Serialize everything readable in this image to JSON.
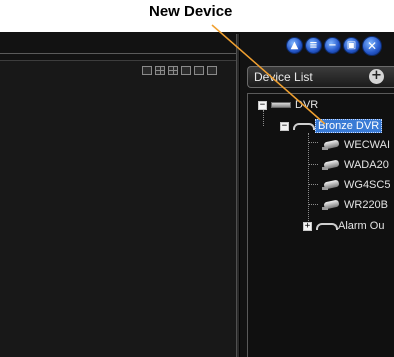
{
  "callout": {
    "text": "New Device"
  },
  "device_list": {
    "title": "Device List",
    "add_symbol": "+"
  },
  "window_buttons": [
    {
      "icon": "lock-icon",
      "symbol": "▲"
    },
    {
      "icon": "list-icon",
      "symbol": "≡"
    },
    {
      "icon": "minimize-icon",
      "symbol": "−"
    },
    {
      "icon": "restore-icon",
      "symbol": "▣"
    },
    {
      "icon": "close-icon",
      "symbol": "✕"
    }
  ],
  "tree": {
    "root": {
      "label": "DVR",
      "toggle": "−"
    },
    "bronze": {
      "label": "Bronze DVR",
      "toggle": "−"
    },
    "cameras": [
      "WECWAI",
      "WADA20",
      "WG4SC5",
      "WR220B"
    ],
    "alarm": {
      "label": "Alarm Ou",
      "toggle": "+"
    }
  },
  "colors": {
    "selection": "#3a7bd5",
    "callout_line": "#f0a030",
    "window_button": "#2456c9"
  }
}
